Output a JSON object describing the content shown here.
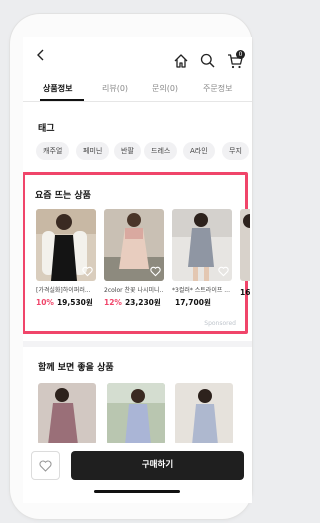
{
  "header": {
    "cart_count": "0"
  },
  "tabs": [
    {
      "label": "상품정보",
      "active": true
    },
    {
      "label": "리뷰(0)",
      "active": false
    },
    {
      "label": "문의(0)",
      "active": false
    },
    {
      "label": "주문정보",
      "active": false
    }
  ],
  "tags": {
    "title": "태그",
    "chips": [
      "캐주얼",
      "페미닌",
      "반팔",
      "드레스",
      "A라인",
      "무지"
    ]
  },
  "trending": {
    "title": "요즘 뜨는 상품",
    "sponsored_label": "Sponsored",
    "products": [
      {
        "name": "[가격실화]하이퍼러...",
        "discount": "10%",
        "price": "19,530원"
      },
      {
        "name": "2color 찬꽃 나시미니...",
        "discount": "12%",
        "price": "23,230원"
      },
      {
        "name": "*3컬러* 스트라이프 ...",
        "discount": "",
        "price": "17,700원"
      },
      {
        "name": "",
        "discount": "",
        "price": "16"
      }
    ]
  },
  "recommended": {
    "title": "함께 보면 좋을 상품"
  },
  "bottom_bar": {
    "buy_label": "구매하기"
  },
  "colors": {
    "accent": "#f0456a",
    "dark": "#1f1f1f"
  }
}
